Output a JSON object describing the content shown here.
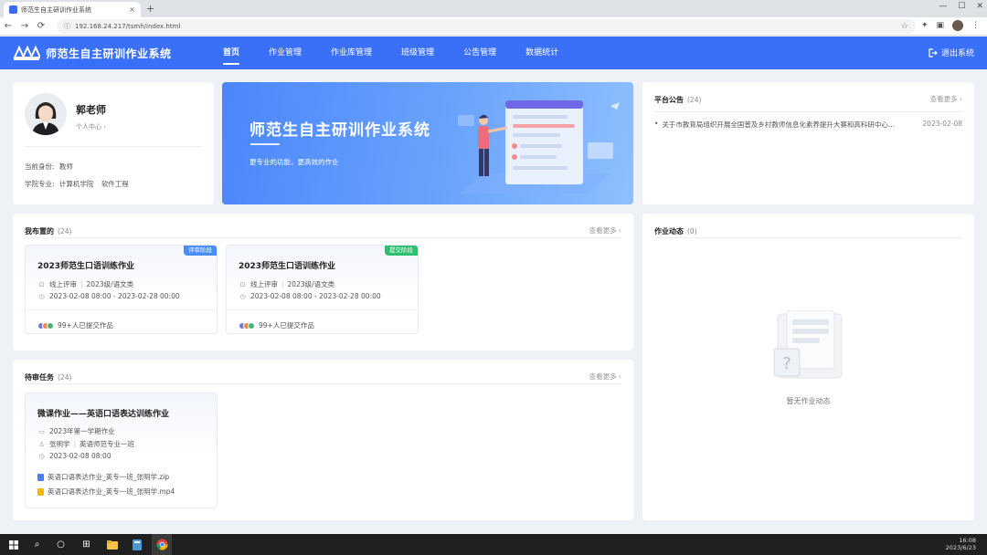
{
  "browser": {
    "tab_title": "师范生自主研训作业系统",
    "url": "192.168.24.217/tsmh/index.html",
    "tab_close": "×",
    "new_tab": "+"
  },
  "app": {
    "title": "师范生自主研训作业系统",
    "logout": "退出系统",
    "nav": [
      "首页",
      "作业管理",
      "作业库管理",
      "班级管理",
      "公告管理",
      "数据统计"
    ]
  },
  "profile": {
    "name": "郭老师",
    "center_link": "个人中心 ›",
    "role_label": "当前身份:",
    "role_value": "教师",
    "major_label": "学院专业:",
    "major_value": "计算机学院",
    "major_value2": "软件工程"
  },
  "banner": {
    "title": "师范生自主研训作业系统",
    "subtitle": "更专业的功能，更高效的作业"
  },
  "notices": {
    "title": "平台公告",
    "count": "(24)",
    "more": "查看更多 ›",
    "items": [
      {
        "text": "关于市教育局组织开展全国普及乡村教师信息化素养提升大赛和高科研中心...",
        "date": "2023-02-08"
      }
    ]
  },
  "published": {
    "title": "我布置的",
    "count": "(24)",
    "more": "查看更多 ›",
    "items": [
      {
        "tag": "评审阶段",
        "title": "2023师范生口语训练作业",
        "review": "线上评审",
        "group": "2023级/语文类",
        "time": "2023-02-08 08:00 - 2023-02-28 00:00",
        "submitted": "99+人已提交作品"
      },
      {
        "tag": "提交阶段",
        "title": "2023师范生口语训练作业",
        "review": "线上评审",
        "group": "2023级/语文类",
        "time": "2023-02-08 08:00 - 2023-02-28 00:00",
        "submitted": "99+人已提交作品"
      }
    ]
  },
  "todo": {
    "title": "待审任务",
    "count": "(24)",
    "more": "查看更多 ›",
    "item": {
      "title": "微课作业——英语口语表达训练作业",
      "term": "2023年第一学期作业",
      "student": "张明学",
      "class": "英语师范专业一班",
      "time": "2023-02-08 08:00",
      "files": [
        "英语口语表达作业_英专一班_张明学.zip",
        "英语口语表达作业_英专一班_张明学.mp4"
      ]
    }
  },
  "dynamics": {
    "title": "作业动态",
    "count": "(0)",
    "empty": "暂无作业动态"
  },
  "taskbar": {
    "time": "16:08",
    "date": "2023/6/23"
  },
  "colors": {
    "brand": "#3a6ff7",
    "tag_review": "#4a8df8",
    "tag_submit": "#2fbf71"
  }
}
